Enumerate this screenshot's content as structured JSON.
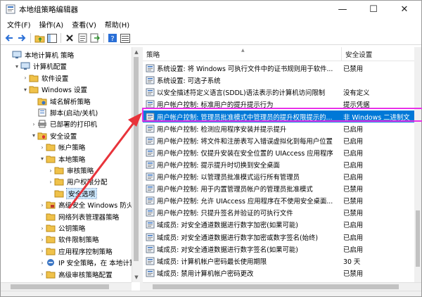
{
  "window": {
    "title": "本地组策略编辑器",
    "minimize": "—",
    "maximize": "☐",
    "close": "✕"
  },
  "menu": [
    "文件(F)",
    "操作(A)",
    "查看(V)",
    "帮助(H)"
  ],
  "toolbar_icons": [
    "back-icon",
    "forward-icon",
    "up-folder-icon",
    "show-hide-tree-icon",
    "delete-icon",
    "properties-icon",
    "export-list-icon",
    "help-icon",
    "view-icon"
  ],
  "tree": [
    {
      "label": "本地计算机 策略",
      "level": 0,
      "icon": "computer-icon",
      "expander": ""
    },
    {
      "label": "计算机配置",
      "level": 1,
      "icon": "computer-icon",
      "expander": "▾"
    },
    {
      "label": "软件设置",
      "level": 2,
      "icon": "folder-icon",
      "expander": "›"
    },
    {
      "label": "Windows 设置",
      "level": 2,
      "icon": "folder-icon",
      "expander": "▾"
    },
    {
      "label": "域名解析策略",
      "level": 3,
      "icon": "dns-icon",
      "expander": ""
    },
    {
      "label": "脚本(启动/关机)",
      "level": 3,
      "icon": "script-icon",
      "expander": ""
    },
    {
      "label": "已部署的打印机",
      "level": 3,
      "icon": "printer-icon",
      "expander": "›"
    },
    {
      "label": "安全设置",
      "level": 3,
      "icon": "security-icon",
      "expander": "▾"
    },
    {
      "label": "帐户策略",
      "level": 4,
      "icon": "folder-icon",
      "expander": "›"
    },
    {
      "label": "本地策略",
      "level": 4,
      "icon": "folder-icon",
      "expander": "▾"
    },
    {
      "label": "审核策略",
      "level": 5,
      "icon": "folder-icon",
      "expander": "›"
    },
    {
      "label": "用户权限分配",
      "level": 5,
      "icon": "folder-icon",
      "expander": "›"
    },
    {
      "label": "安全选项",
      "level": 5,
      "icon": "folder-icon",
      "expander": "",
      "selected": true
    },
    {
      "label": "高级安全 Windows 防火墙",
      "level": 4,
      "icon": "firewall-icon",
      "expander": "›"
    },
    {
      "label": "网络列表管理器策略",
      "level": 4,
      "icon": "folder-icon",
      "expander": ""
    },
    {
      "label": "公钥策略",
      "level": 4,
      "icon": "folder-icon",
      "expander": "›"
    },
    {
      "label": "软件限制策略",
      "level": 4,
      "icon": "folder-icon",
      "expander": "›"
    },
    {
      "label": "应用程序控制策略",
      "level": 4,
      "icon": "folder-icon",
      "expander": "›"
    },
    {
      "label": "IP 安全策略，在 本地计算机",
      "level": 4,
      "icon": "ip-security-icon",
      "expander": "›"
    },
    {
      "label": "高级审核策略配置",
      "level": 4,
      "icon": "folder-icon",
      "expander": "›"
    }
  ],
  "list": {
    "columns": {
      "policy": "策略",
      "setting": "安全设置"
    },
    "rows": [
      {
        "policy": "系统设置: 将 Windows 可执行文件中的证书规则用于软件...",
        "setting": "已禁用"
      },
      {
        "policy": "系统设置: 可选子系统",
        "setting": ""
      },
      {
        "policy": "以安全描述符定义语言(SDDL)语法表示的计算机访问限制",
        "setting": "没有定义"
      },
      {
        "policy": "用户帐户控制: 标准用户的提升提示行为",
        "setting": "提示凭据"
      },
      {
        "policy": "用户帐户控制: 管理员批准模式中管理员的提升权限提示的...",
        "setting": "非 Windows 二进制文",
        "highlight": true
      },
      {
        "policy": "用户帐户控制: 检测应用程序安装并提示提升",
        "setting": "已启用"
      },
      {
        "policy": "用户帐户控制: 将文件和注册表写入错误虚拟化到每用户位置",
        "setting": "已启用"
      },
      {
        "policy": "用户帐户控制: 仅提升安装在安全位置的 UIAccess 应用程序",
        "setting": "已启用"
      },
      {
        "policy": "用户帐户控制: 提示提升时切换到安全桌面",
        "setting": "已启用"
      },
      {
        "policy": "用户帐户控制: 以管理员批准模式运行所有管理员",
        "setting": "已启用"
      },
      {
        "policy": "用户帐户控制: 用于内置管理员帐户的管理员批准模式",
        "setting": "已禁用"
      },
      {
        "policy": "用户帐户控制: 允许 UIAccess 应用程序在不使用安全桌面...",
        "setting": "已禁用"
      },
      {
        "policy": "用户帐户控制: 只提升签名并验证的可执行文件",
        "setting": "已禁用"
      },
      {
        "policy": "域成员: 对安全通道数据进行数字加密(如果可能)",
        "setting": "已启用"
      },
      {
        "policy": "域成员: 对安全通道数据进行数字加密或数字签名(始终)",
        "setting": "已启用"
      },
      {
        "policy": "域成员: 对安全通道数据进行数字签名(如果可能)",
        "setting": "已启用"
      },
      {
        "policy": "域成员: 计算机帐户密码最长使用期限",
        "setting": "30 天"
      },
      {
        "policy": "域成员: 禁用计算机帐户密码更改",
        "setting": "已禁用"
      }
    ]
  },
  "colors": {
    "selection": "#0078d7",
    "annotation": "#e830e8",
    "arrow": "#e8333a",
    "folder": "#f0c24a"
  }
}
